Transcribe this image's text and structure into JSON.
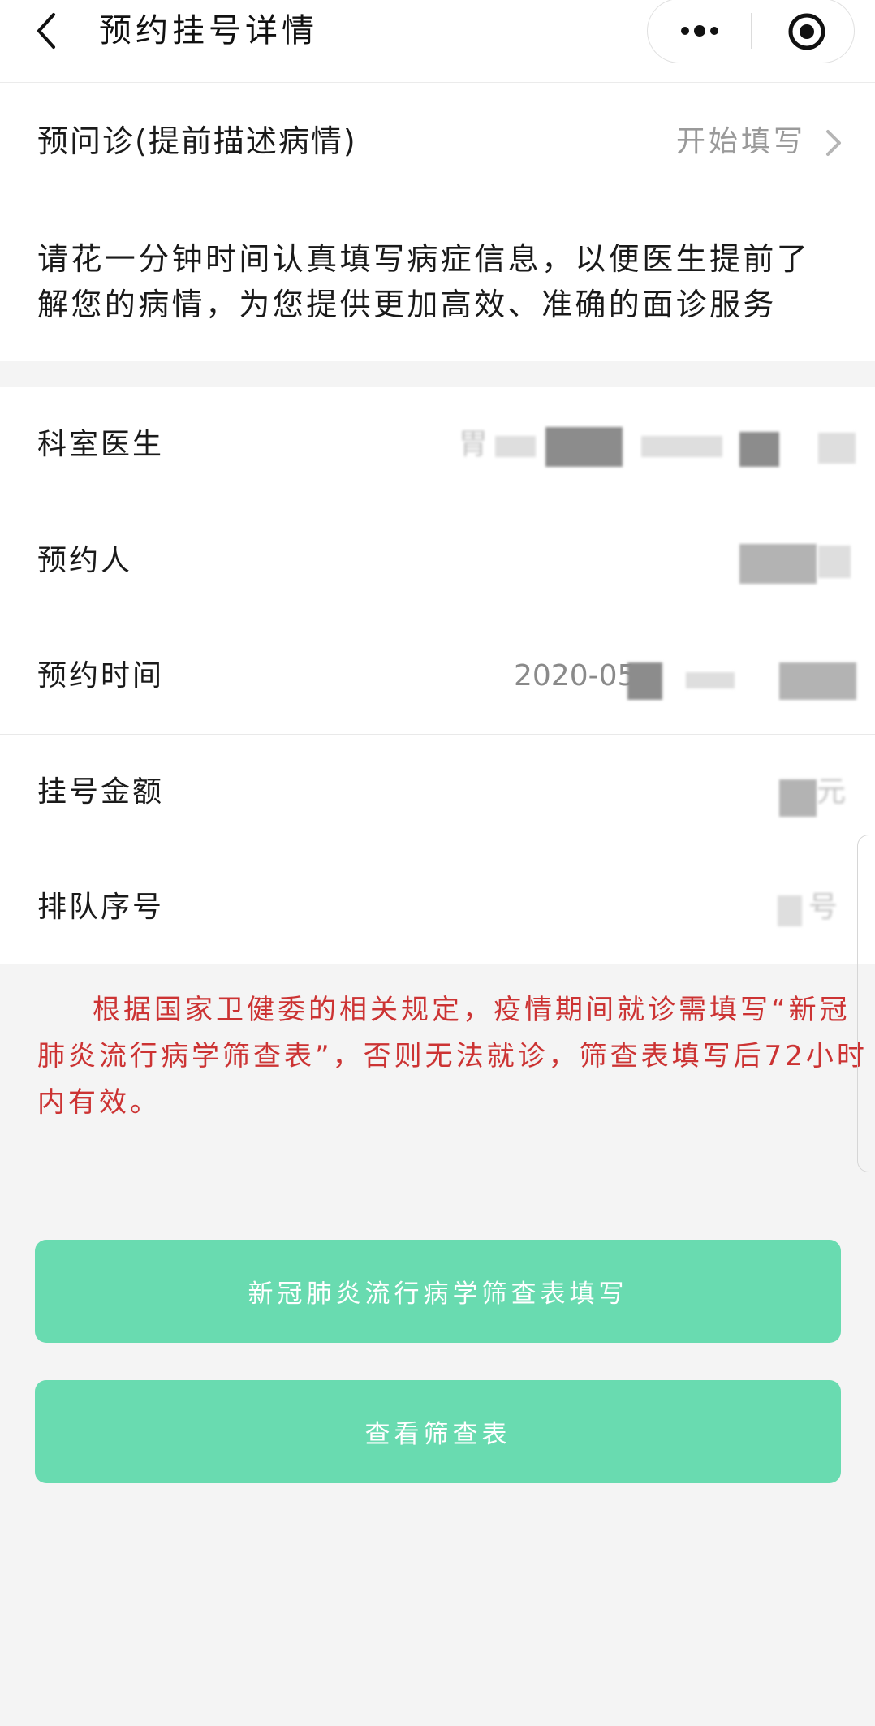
{
  "header": {
    "title": "预约挂号详情",
    "back_icon": "chevron-left-icon",
    "more_icon": "more-dots-icon",
    "close_icon": "target-circle-icon"
  },
  "pre_consult": {
    "label": "预问诊(提前描述病情)",
    "action": "开始填写"
  },
  "description": {
    "lines": [
      "请花一分钟时间认真填写病症信息，以便医生提前了",
      "解您的病情，为您提供更加高效、准确的面诊服务"
    ]
  },
  "details": [
    {
      "label": "科室医生",
      "value": "胃"
    },
    {
      "label": "预约人"
    },
    {
      "label": "预约时间",
      "value": "2020-05"
    },
    {
      "label": "挂号金额",
      "value": "元"
    },
    {
      "label": "排队序号",
      "value": "号"
    }
  ],
  "notice": {
    "lines": [
      "根据国家卫健委的相关规定，疫情期间就诊需填写“新冠",
      "肺炎流行病学筛查表”，否则无法就诊，筛查表填写后72小时",
      "内有效。"
    ]
  },
  "buttons": {
    "fill_form": "新冠肺炎流行病学筛查表填写",
    "view_form": "查看筛查表"
  },
  "colors": {
    "accent_button": "#69dbb0",
    "notice_text": "#cc3333",
    "muted_text": "#9a9a9a",
    "background": "#f4f4f4"
  }
}
